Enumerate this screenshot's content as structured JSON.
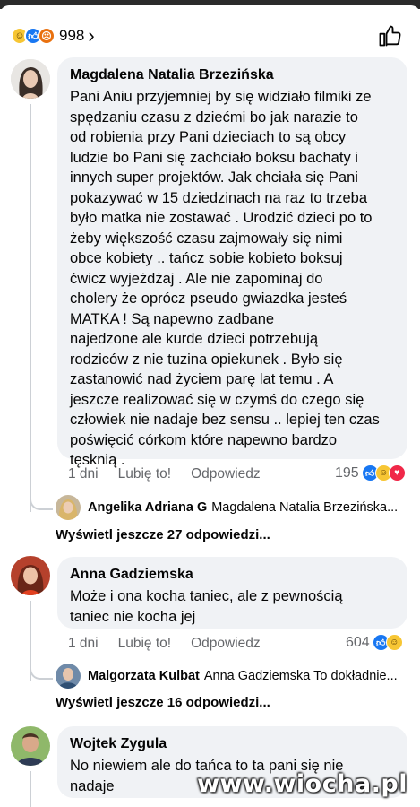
{
  "summary": {
    "count": "998",
    "chevron": "›",
    "emojis": [
      "haha",
      "like",
      "angry"
    ]
  },
  "comments": [
    {
      "author": "Magdalena Natalia Brzezińska",
      "text": "Pani Aniu przyjemniej by się widziało filmiki ze\nspędzaniu czasu z dziećmi bo jak narazie to\nod robienia przy Pani dzieciach to są obcy\nludzie bo Pani się zachciało boksu bachaty i\ninnych super projektów. Jak chciała się Pani\npokazywać w 15 dziedzinach na raz to trzeba\nbyło matka nie zostawać . Urodzić dzieci po to\nżeby większość czasu zajmowały się nimi\nobce kobiety .. tańcz sobie kobieto boksuj\nćwicz wyjeżdżaj . Ale nie zapominaj do\ncholery że oprócz pseudo gwiazdka jesteś\nMATKA ! Są napewno zadbane\nnajedzone ale kurde dzieci potrzebują\nrodziców z nie tuzina opiekunek . Było się\nzastanowić nad życiem parę lat temu . A\njeszcze realizować się w czymś do czego się\nczłowiek nie nadaje bez sensu .. lepiej ten czas\npoświęcić córkom które napewno bardzo\ntęsknią .",
      "time": "1 dni",
      "like": "Lubię to!",
      "reply": "Odpowiedz",
      "reactions": "195",
      "reply_preview": {
        "name": "Angelika Adriana G",
        "text": "Magdalena Natalia Brzezińska..."
      },
      "more": "Wyświetl jeszcze 27 odpowiedzi..."
    },
    {
      "author": "Anna Gadziemska",
      "text": "Może i ona kocha taniec, ale z pewnością\ntaniec nie kocha jej",
      "time": "1 dni",
      "like": "Lubię to!",
      "reply": "Odpowiedz",
      "reactions": "604",
      "reply_preview": {
        "name": "Malgorzata Kulbat",
        "text": "Anna Gadziemska To dokładnie..."
      },
      "more": "Wyświetl jeszcze 16 odpowiedzi..."
    },
    {
      "author": "Wojtek Zygula",
      "text": "No niewiem ale do tańca to ta pani się nie\nnadaje"
    }
  ],
  "watermark": "www.wiocha.pl"
}
